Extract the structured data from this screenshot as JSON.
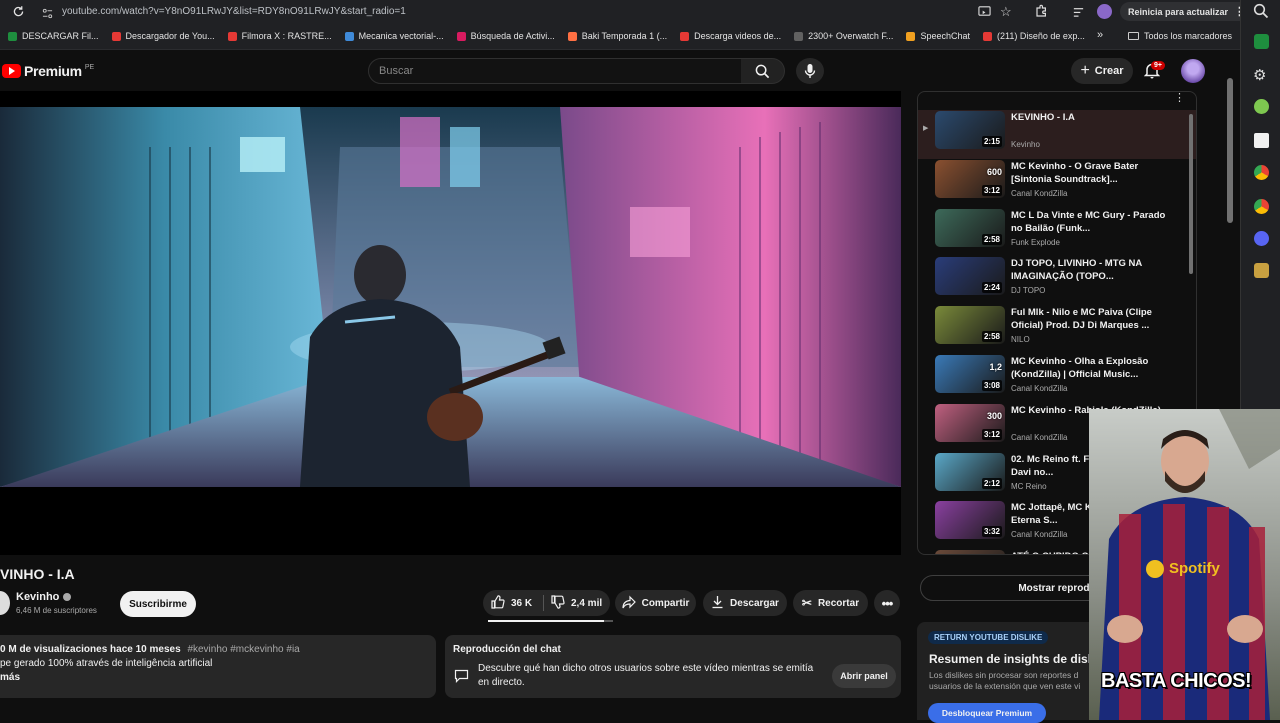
{
  "browser": {
    "url": "youtube.com/watch?v=Y8nO91LRwJY&list=RDY8nO91LRwJY&start_radio=1",
    "update_button": "Reinicia para actualizar",
    "bookmarks": [
      {
        "label": "DESCARGAR Fil...",
        "color": "#1e8e3e"
      },
      {
        "label": "Descargador de You...",
        "color": "#e53935"
      },
      {
        "label": "Filmora X : RASTRE...",
        "color": "#e53935"
      },
      {
        "label": "Mecanica vectorial-...",
        "color": "#3f8ad8"
      },
      {
        "label": "Búsqueda de Activi...",
        "color": "#d81b60"
      },
      {
        "label": "Baki Temporada 1 (...",
        "color": "#ff7043"
      },
      {
        "label": "Descarga videos de...",
        "color": "#e53935"
      },
      {
        "label": "2300+ Overwatch F...",
        "color": "#616161"
      },
      {
        "label": "SpeechChat",
        "color": "#f0a020"
      },
      {
        "label": "(211) Diseño de exp...",
        "color": "#e53935"
      }
    ],
    "all_bookmarks": "Todos los marcadores"
  },
  "youtube": {
    "logo_text": "Premium",
    "logo_region": "PE",
    "search_placeholder": "Buscar",
    "create_label": "Crear",
    "notif_badge": "9+"
  },
  "video": {
    "title": "VINHO - I.A",
    "channel": "Kevinho",
    "subscribers": "6,46 M de suscriptores",
    "subscribe_label": "Suscribirme",
    "likes": "36 K",
    "dislikes": "2,4 mil",
    "share_label": "Compartir",
    "download_label": "Descargar",
    "clip_label": "Recortar",
    "views_line": "0 M de visualizaciones  hace 10 meses",
    "hashtags": "#kevinho #mckevinho #ia",
    "description": "pe gerado 100% através de inteligência artificial",
    "more": "más"
  },
  "chat_replay": {
    "title": "Reproducción del chat",
    "text": "Descubre qué han dicho otros usuarios sobre este vídeo mientras se emitía en directo.",
    "button": "Abrir panel"
  },
  "playlist": {
    "items": [
      {
        "title": "KEVINHO - I.A",
        "channel": "Kevinho",
        "duration": "2:15",
        "thumb": "#2b4a6e",
        "badge": ""
      },
      {
        "title": "MC Kevinho - O Grave Bater [Sintonia Soundtrack]...",
        "channel": "Canal KondZilla",
        "duration": "3:12",
        "thumb": "#8a5030",
        "badge": "600"
      },
      {
        "title": "MC L Da Vinte e MC Gury - Parado no Bailão (Funk...",
        "channel": "Funk Explode",
        "duration": "2:58",
        "thumb": "#3d6a5a",
        "badge": ""
      },
      {
        "title": "DJ TOPO, LIVINHO - MTG NA IMAGINAÇÃO (TOPO...",
        "channel": "DJ TOPO",
        "duration": "2:24",
        "thumb": "#2a3d7a",
        "badge": ""
      },
      {
        "title": "Ful Mlk - Nilo e MC Paiva (Clipe Oficial) Prod. DJ Di Marques ...",
        "channel": "NILO",
        "duration": "2:58",
        "thumb": "#7a8a3a",
        "badge": ""
      },
      {
        "title": "MC Kevinho - Olha a Explosão (KondZilla) | Official Music...",
        "channel": "Canal KondZilla",
        "duration": "3:08",
        "thumb": "#3a7ab8",
        "badge": "1,2"
      },
      {
        "title": "MC Kevinho - Rabiola (KondZilla)",
        "channel": "Canal KondZilla",
        "duration": "3:12",
        "thumb": "#c06080",
        "badge": "300"
      },
      {
        "title": "02. Mc Reino ft. Fi... Isca (Prod. Davi no...",
        "channel": "MC Reino",
        "duration": "2:12",
        "thumb": "#5aa8c8",
        "badge": ""
      },
      {
        "title": "MC Jottapê, MC K... Kevinho - Eterna S...",
        "channel": "Canal KondZilla",
        "duration": "3:32",
        "thumb": "#8a40a0",
        "badge": ""
      },
      {
        "title": "ATÉ O CUPIDO CH...",
        "channel": "",
        "duration": "",
        "thumb": "#6a4a3a",
        "badge": ""
      }
    ],
    "show_chat_replay": "Mostrar reproducción"
  },
  "dislike_panel": {
    "tag": "RETURN YOUTUBE DISLIKE",
    "title": "Resumen de insights de disli",
    "text_1": "Los dislikes sin procesar son reportes d",
    "text_2": "usuarios de la extensión que ven este vi",
    "button": "Desbloquear Premium"
  },
  "webcam": {
    "shirt_brand": "Spotify",
    "caption": "BASTA CHICOS!"
  }
}
